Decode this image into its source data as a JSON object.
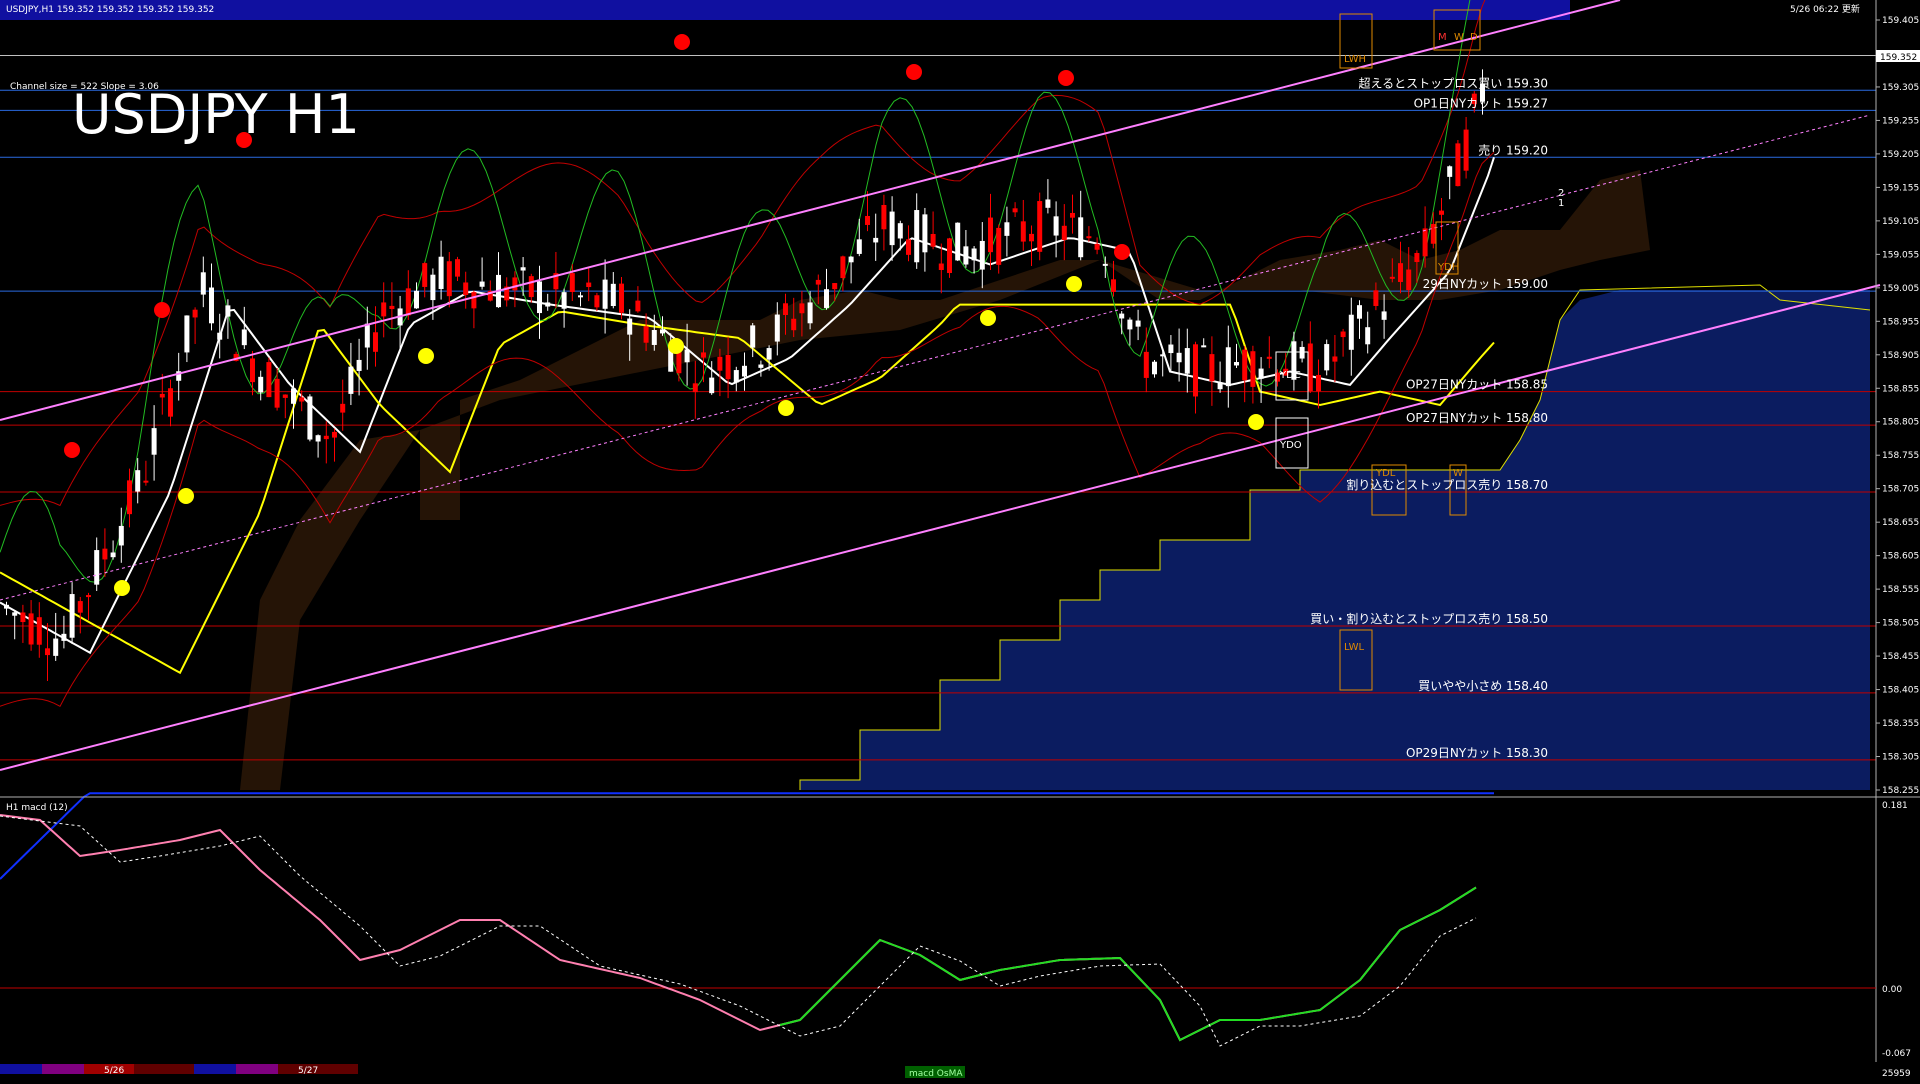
{
  "header": {
    "symbol_info": "USDJPY,H1 159.352 159.352 159.352 159.352",
    "datetime": "5/26 06:22 更新"
  },
  "chart": {
    "big_title": "USDJPY H1",
    "channel_info": "Channel size = 522 Slope = 3.06",
    "current_price": "159.352",
    "price_ticks": [
      "159.405",
      "159.352",
      "159.305",
      "159.255",
      "159.205",
      "159.155",
      "159.105",
      "159.055",
      "159.005",
      "158.955",
      "158.905",
      "158.855",
      "158.805",
      "158.755",
      "158.705",
      "158.655",
      "158.605",
      "158.555",
      "158.505",
      "158.455",
      "158.405",
      "158.355",
      "158.305",
      "158.255"
    ],
    "level_labels": [
      {
        "text": "超えるとストップロス買い 159.30",
        "color": "#ffffff"
      },
      {
        "text": "OP1日NYカット 159.27",
        "color": "#ffffff"
      },
      {
        "text": "売り 159.20",
        "color": "#ffffff"
      },
      {
        "text": "29日NYカット 159.00",
        "color": "#ffffff"
      },
      {
        "text": "OP27日NYカット 158.85",
        "color": "#ffffff"
      },
      {
        "text": "OP27日NYカット 158.80",
        "color": "#ffffff"
      },
      {
        "text": "割り込むとストップロス売り 158.70",
        "color": "#ffffff"
      },
      {
        "text": "買い・割り込むとストップロス売り 158.50",
        "color": "#ffffff"
      },
      {
        "text": "買いやや小さめ 158.40",
        "color": "#ffffff"
      },
      {
        "text": "OP29日NYカット 158.30",
        "color": "#ffffff"
      }
    ],
    "box_labels": [
      "LWH",
      "M",
      "W",
      "D",
      "YDH",
      "YDC",
      "YDO",
      "YDL",
      "W",
      "LWL"
    ],
    "line_markers": [
      "2",
      "1"
    ]
  },
  "macd_panel": {
    "title": "H1  macd (12)",
    "ticks": [
      "0.181",
      "0.00",
      "-0.067"
    ]
  },
  "bottom_bar": {
    "dates": [
      "5/26",
      "5/27"
    ],
    "tab_label": "macd OsMA",
    "counter": "25959"
  },
  "colors": {
    "bg": "#000000",
    "bull": "#ffffff",
    "bear": "#ff0000",
    "channel": "#ff80ff",
    "ma_white": "#ffffff",
    "ma_yellow": "#ffff00",
    "ma_blue": "#1030ff",
    "macd_up": "#22dd22",
    "macd_down": "#ff80b0",
    "cloud": "#1a3aa0",
    "header_band": "#1010a0"
  }
}
